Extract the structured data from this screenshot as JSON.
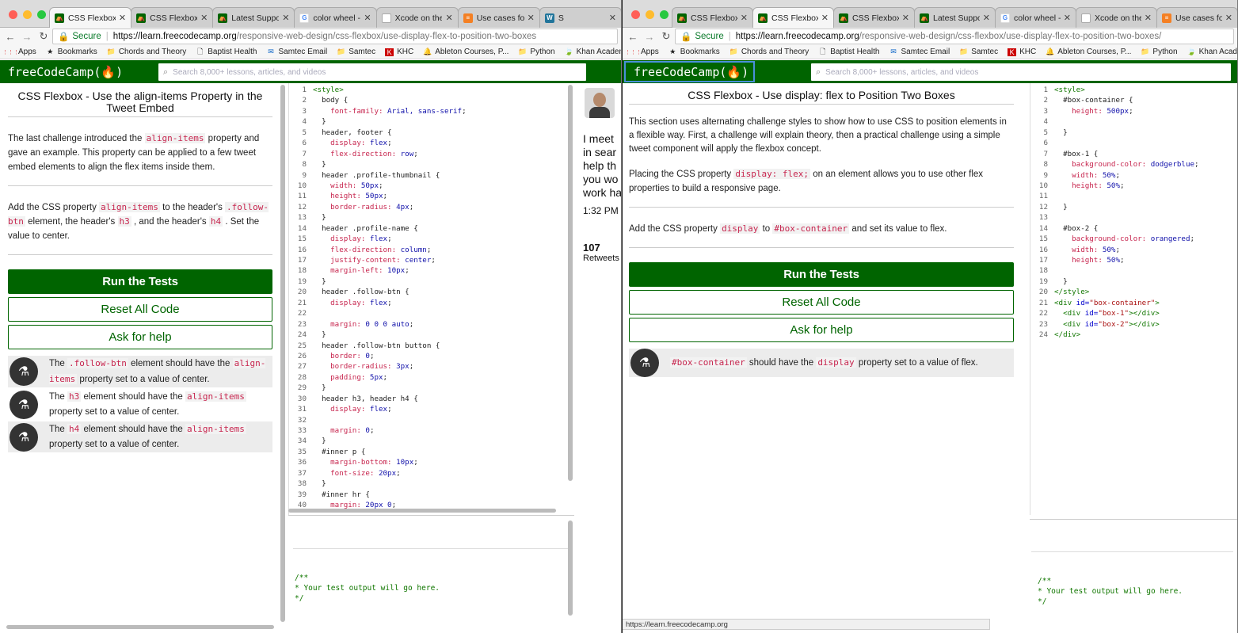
{
  "left": {
    "tabs": [
      {
        "label": "CSS Flexbox - Use",
        "fav": "fcc"
      },
      {
        "label": "CSS Flexbox - Use",
        "fav": "fcc"
      },
      {
        "label": "Latest Support to",
        "fav": "fcc"
      },
      {
        "label": "color wheel - Goo",
        "fav": "google"
      },
      {
        "label": "Xcode on the Mac",
        "fav": "apple"
      },
      {
        "label": "Use cases for usi",
        "fav": "stack"
      },
      {
        "label": "S",
        "fav": "wp"
      }
    ],
    "url": {
      "host": "https://learn.freecodecamp.org",
      "path": "/responsive-web-design/css-flexbox/use-display-flex-to-position-two-boxes"
    },
    "search_placeholder": "Search 8,000+ lessons, articles, and videos",
    "challenge_title": "CSS Flexbox - Use the align-items Property in the Tweet Embed",
    "desc1": {
      "a": "The last challenge introduced the ",
      "code": "align-items",
      "b": " property and gave an example. This property can be applied to a few tweet embed elements to align the flex items inside them."
    },
    "desc2": {
      "a": "Add the CSS property ",
      "c1": "align-items",
      "b": " to the header's ",
      "c2": ".follow-btn",
      "c": " element, the header's ",
      "c3": "h3",
      "d": " , and the header's ",
      "c4": "h4",
      "e": " . Set the value to center."
    },
    "tests": [
      {
        "a": "The ",
        "c1": ".follow-btn",
        "b": " element should have the ",
        "c2": "align-items",
        "c": " property set to a value of center."
      },
      {
        "a": "The ",
        "c1": "h3",
        "b": " element should have the ",
        "c2": "align-items",
        "c": " property set to a value of center."
      },
      {
        "a": "The ",
        "c1": "h4",
        "b": " element should have the ",
        "c2": "align-items",
        "c": " property set to a value of center."
      }
    ],
    "code_lines": [
      [
        [
          "t",
          "<style>"
        ]
      ],
      [
        [
          "s",
          "  body {"
        ]
      ],
      [
        [
          "p",
          "    font-family: "
        ],
        [
          "v",
          "Arial, sans-serif"
        ],
        [
          "s",
          ";"
        ]
      ],
      [
        [
          "s",
          "  }"
        ]
      ],
      [
        [
          "s",
          "  header, footer {"
        ]
      ],
      [
        [
          "p",
          "    display: "
        ],
        [
          "v",
          "flex"
        ],
        [
          "s",
          ";"
        ]
      ],
      [
        [
          "p",
          "    flex-direction: "
        ],
        [
          "v",
          "row"
        ],
        [
          "s",
          ";"
        ]
      ],
      [
        [
          "s",
          "  }"
        ]
      ],
      [
        [
          "s",
          "  header .profile-thumbnail {"
        ]
      ],
      [
        [
          "p",
          "    width: "
        ],
        [
          "v",
          "50px"
        ],
        [
          "s",
          ";"
        ]
      ],
      [
        [
          "p",
          "    height: "
        ],
        [
          "v",
          "50px"
        ],
        [
          "s",
          ";"
        ]
      ],
      [
        [
          "p",
          "    border-radius: "
        ],
        [
          "v",
          "4px"
        ],
        [
          "s",
          ";"
        ]
      ],
      [
        [
          "s",
          "  }"
        ]
      ],
      [
        [
          "s",
          "  header .profile-name {"
        ]
      ],
      [
        [
          "p",
          "    display: "
        ],
        [
          "v",
          "flex"
        ],
        [
          "s",
          ";"
        ]
      ],
      [
        [
          "p",
          "    flex-direction: "
        ],
        [
          "v",
          "column"
        ],
        [
          "s",
          ";"
        ]
      ],
      [
        [
          "p",
          "    justify-content: "
        ],
        [
          "v",
          "center"
        ],
        [
          "s",
          ";"
        ]
      ],
      [
        [
          "p",
          "    margin-left: "
        ],
        [
          "v",
          "10px"
        ],
        [
          "s",
          ";"
        ]
      ],
      [
        [
          "s",
          "  }"
        ]
      ],
      [
        [
          "s",
          "  header .follow-btn {"
        ]
      ],
      [
        [
          "p",
          "    display: "
        ],
        [
          "v",
          "flex"
        ],
        [
          "s",
          ";"
        ]
      ],
      [
        [
          "s",
          ""
        ]
      ],
      [
        [
          "p",
          "    margin: "
        ],
        [
          "v",
          "0 0 0 auto"
        ],
        [
          "s",
          ";"
        ]
      ],
      [
        [
          "s",
          "  }"
        ]
      ],
      [
        [
          "s",
          "  header .follow-btn button {"
        ]
      ],
      [
        [
          "p",
          "    border: "
        ],
        [
          "v",
          "0"
        ],
        [
          "s",
          ";"
        ]
      ],
      [
        [
          "p",
          "    border-radius: "
        ],
        [
          "v",
          "3px"
        ],
        [
          "s",
          ";"
        ]
      ],
      [
        [
          "p",
          "    padding: "
        ],
        [
          "v",
          "5px"
        ],
        [
          "s",
          ";"
        ]
      ],
      [
        [
          "s",
          "  }"
        ]
      ],
      [
        [
          "s",
          "  header h3, header h4 {"
        ]
      ],
      [
        [
          "p",
          "    display: "
        ],
        [
          "v",
          "flex"
        ],
        [
          "s",
          ";"
        ]
      ],
      [
        [
          "s",
          ""
        ]
      ],
      [
        [
          "p",
          "    margin: "
        ],
        [
          "v",
          "0"
        ],
        [
          "s",
          ";"
        ]
      ],
      [
        [
          "s",
          "  }"
        ]
      ],
      [
        [
          "s",
          "  #inner p {"
        ]
      ],
      [
        [
          "p",
          "    margin-bottom: "
        ],
        [
          "v",
          "10px"
        ],
        [
          "s",
          ";"
        ]
      ],
      [
        [
          "p",
          "    font-size: "
        ],
        [
          "v",
          "20px"
        ],
        [
          "s",
          ";"
        ]
      ],
      [
        [
          "s",
          "  }"
        ]
      ],
      [
        [
          "s",
          "  #inner hr {"
        ]
      ],
      [
        [
          "p",
          "    margin: "
        ],
        [
          "v",
          "20px 0"
        ],
        [
          "s",
          ";"
        ]
      ]
    ],
    "output": "/**\n* Your test output will go here.\n*/",
    "tweet": {
      "text": "I meet\nin sear\nhelp th\nyou wo\nwork ha",
      "time": "1:32 PM",
      "count": "107",
      "count_label": "Retweets"
    }
  },
  "right": {
    "tabs": [
      {
        "label": "CSS Flexbox | f",
        "fav": "fcc"
      },
      {
        "label": "CSS Flexbox - U",
        "fav": "fcc"
      },
      {
        "label": "CSS Flexbox - U",
        "fav": "fcc"
      },
      {
        "label": "Latest Support",
        "fav": "fcc"
      },
      {
        "label": "color wheel - G",
        "fav": "google"
      },
      {
        "label": "Xcode on the M",
        "fav": "apple"
      },
      {
        "label": "Use cases for",
        "fav": "stack"
      }
    ],
    "url": {
      "host": "https://learn.freecodecamp.org",
      "path": "/responsive-web-design/css-flexbox/use-display-flex-to-position-two-boxes/"
    },
    "search_placeholder": "Search 8,000+ lessons, articles, and videos",
    "challenge_title": "CSS Flexbox - Use display: flex to Position Two Boxes",
    "desc1": "This section uses alternating challenge styles to show how to use CSS to position elements in a flexible way. First, a challenge will explain theory, then a practical challenge using a simple tweet component will apply the flexbox concept.",
    "desc2": {
      "a": "Placing the CSS property ",
      "code": "display: flex;",
      "b": " on an element allows you to use other flex properties to build a responsive page."
    },
    "desc3": {
      "a": "Add the CSS property ",
      "c1": "display",
      "b": " to ",
      "c2": "#box-container",
      "c": " and set its value to flex."
    },
    "tests": [
      {
        "c1": "#box-container",
        "b": " should have the ",
        "c2": "display",
        "c": " property set to a value of flex."
      }
    ],
    "code_lines": [
      [
        [
          "t",
          "<style>"
        ]
      ],
      [
        [
          "s",
          "  #box-container {"
        ]
      ],
      [
        [
          "p",
          "    height: "
        ],
        [
          "v",
          "500px"
        ],
        [
          "s",
          ";"
        ]
      ],
      [
        [
          "s",
          ""
        ]
      ],
      [
        [
          "s",
          "  }"
        ]
      ],
      [
        [
          "s",
          ""
        ]
      ],
      [
        [
          "s",
          "  #box-1 {"
        ]
      ],
      [
        [
          "p",
          "    background-color: "
        ],
        [
          "v",
          "dodgerblue"
        ],
        [
          "s",
          ";"
        ]
      ],
      [
        [
          "p",
          "    width: "
        ],
        [
          "v",
          "50%"
        ],
        [
          "s",
          ";"
        ]
      ],
      [
        [
          "p",
          "    height: "
        ],
        [
          "v",
          "50%"
        ],
        [
          "s",
          ";"
        ]
      ],
      [
        [
          "s",
          ""
        ]
      ],
      [
        [
          "s",
          "  }"
        ]
      ],
      [
        [
          "s",
          ""
        ]
      ],
      [
        [
          "s",
          "  #box-2 {"
        ]
      ],
      [
        [
          "p",
          "    background-color: "
        ],
        [
          "v",
          "orangered"
        ],
        [
          "s",
          ";"
        ]
      ],
      [
        [
          "p",
          "    width: "
        ],
        [
          "v",
          "50%"
        ],
        [
          "s",
          ";"
        ]
      ],
      [
        [
          "p",
          "    height: "
        ],
        [
          "v",
          "50%"
        ],
        [
          "s",
          ";"
        ]
      ],
      [
        [
          "s",
          ""
        ]
      ],
      [
        [
          "s",
          "  }"
        ]
      ],
      [
        [
          "t",
          "</style>"
        ]
      ],
      [
        [
          "t",
          "<div "
        ],
        [
          "a",
          "id="
        ],
        [
          "r",
          "\"box-container\""
        ],
        [
          "t",
          ">"
        ]
      ],
      [
        [
          "t",
          "  <div "
        ],
        [
          "a",
          "id="
        ],
        [
          "r",
          "\"box-1\""
        ],
        [
          "t",
          "></div>"
        ]
      ],
      [
        [
          "t",
          "  <div "
        ],
        [
          "a",
          "id="
        ],
        [
          "r",
          "\"box-2\""
        ],
        [
          "t",
          "></div>"
        ]
      ],
      [
        [
          "t",
          "</div>"
        ]
      ]
    ],
    "output": "/**\n* Your test output will go here.\n*/",
    "status_url": "https://learn.freecodecamp.org"
  },
  "common": {
    "secure": "Secure",
    "bookmarks": [
      "Apps",
      "Bookmarks",
      "Chords and Theory",
      "Baptist Health",
      "Samtec Email",
      "Samtec",
      "KHC",
      "Ableton Courses, P...",
      "Python",
      "Khan Academy | Fr..."
    ],
    "logo": "freeCodeCamp(🔥)",
    "run_tests": "Run the Tests",
    "reset": "Reset All Code",
    "help": "Ask for help"
  },
  "colors": {
    "fcc_green": "#006400",
    "code_red": "#c7254e",
    "close": "#ff5f57",
    "min": "#febc2e",
    "max": "#28c840"
  }
}
